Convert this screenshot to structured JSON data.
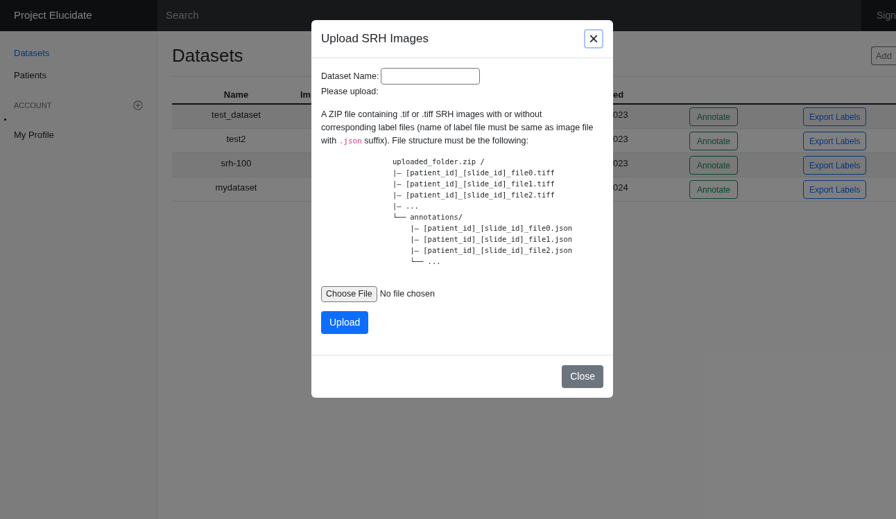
{
  "navbar": {
    "brand": "Project Elucidate",
    "search": {
      "placeholder": "Search"
    },
    "sign_link": "Sign"
  },
  "sidebar": {
    "items": [
      {
        "label": "Datasets",
        "selected": true
      },
      {
        "label": "Patients",
        "selected": false
      }
    ],
    "section": "ACCOUNT",
    "account_items": [
      {
        "label": "My Profile",
        "selected": false
      }
    ]
  },
  "main": {
    "title": "Datasets",
    "add_button": "Add",
    "table": {
      "columns": [
        "Name",
        "Im",
        "ed"
      ],
      "rows": [
        {
          "name": "test_dataset",
          "column_3": "023",
          "annotate": "Annotate",
          "export": "Export Labels"
        },
        {
          "name": "test2",
          "column_3": "023",
          "annotate": "Annotate",
          "export": "Export Labels"
        },
        {
          "name": "srh-100",
          "column_3": "023",
          "annotate": "Annotate",
          "export": "Export Labels"
        },
        {
          "name": "mydataset",
          "column_3": "024",
          "annotate": "Annotate",
          "export": "Export Labels"
        }
      ]
    }
  },
  "modal": {
    "title": "Upload SRH Images",
    "close_icon": "×",
    "dataset_name_label": "Dataset Name:",
    "please_upload": "Please upload:",
    "description_before": "A ZIP file containing .tif or .tiff SRH images with or without corresponding label files (name of label file must be same as image file with ",
    "description_code": ".json",
    "description_after": " suffix). File structure must be the following:",
    "structure": [
      "uploaded_folder.zip /",
      "|— [patient_id]_[slide_id]_file0.tiff",
      "|— [patient_id]_[slide_id]_file1.tiff",
      "|— [patient_id]_[slide_id]_file2.tiff",
      "|— ...",
      "└── annotations/",
      "    |— [patient_id]_[slide_id]_file0.json",
      "    |— [patient_id]_[slide_id]_file1.json",
      "    |— [patient_id]_[slide_id]_file2.json",
      "    └── ..."
    ],
    "choose_file": "Choose File",
    "no_file": "No file chosen",
    "upload_button": "Upload",
    "close_button": "Close"
  }
}
